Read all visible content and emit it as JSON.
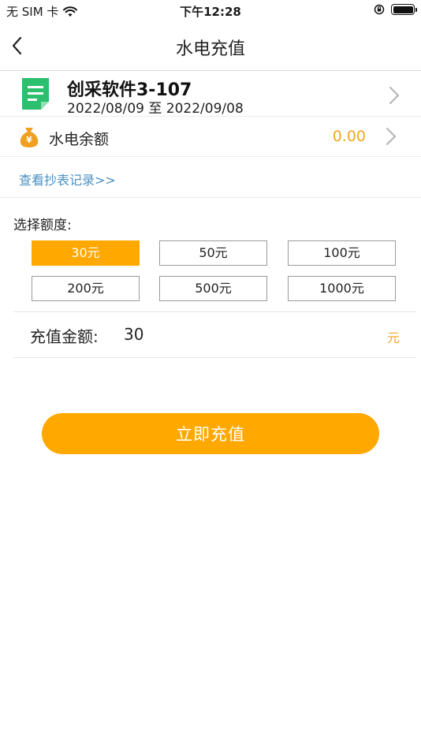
{
  "status_bar": {
    "carrier": "无 SIM 卡",
    "time": "下午12:28"
  },
  "nav": {
    "title": "水电充值"
  },
  "room": {
    "name": "创采软件3-107",
    "start_date": "2022/08/09",
    "separator": "至",
    "end_date": "2022/09/08",
    "icon": "document-icon"
  },
  "balance": {
    "label": "水电余额",
    "value": "0.00",
    "icon": "money-bag-icon"
  },
  "records": {
    "link": "查看抄表记录>>"
  },
  "amounts": {
    "label": "选择额度:",
    "options": [
      "30元",
      "50元",
      "100元",
      "200元",
      "500元",
      "1000元"
    ],
    "selected_index": 0
  },
  "charge": {
    "label": "充值金额:",
    "value": "30",
    "unit": "元"
  },
  "submit": {
    "label": "立即充值"
  },
  "colors": {
    "accent": "#ffa800",
    "link": "#4a90c2",
    "icon_green": "#2bbf6e"
  }
}
